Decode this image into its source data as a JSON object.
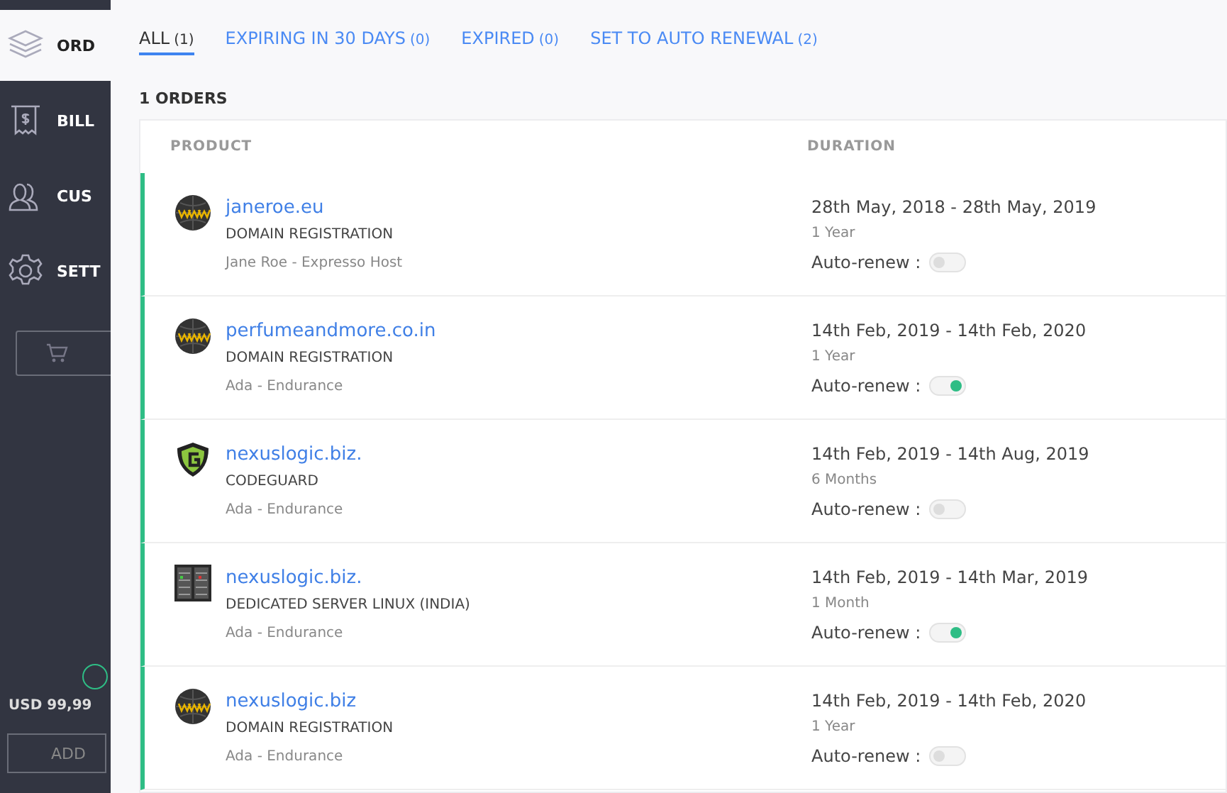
{
  "sidebar": {
    "items": [
      {
        "kind": "layers",
        "label": "ORD",
        "selected": true
      },
      {
        "kind": "receipt",
        "label": "BILL",
        "selected": false
      },
      {
        "kind": "users",
        "label": "CUS",
        "selected": false
      },
      {
        "kind": "gear",
        "label": "SETT",
        "selected": false
      }
    ],
    "cart_button": {
      "kind": "cart"
    },
    "balance": "USD 99,99",
    "add_button": "ADD"
  },
  "tabs": [
    {
      "label": "ALL",
      "count": "(1)",
      "selected": true
    },
    {
      "label": "EXPIRING IN 30 DAYS",
      "count": "(0)",
      "selected": false
    },
    {
      "label": "EXPIRED",
      "count": "(0)",
      "selected": false
    },
    {
      "label": "SET TO AUTO RENEWAL",
      "count": "(2)",
      "selected": false
    }
  ],
  "orders_count": "1 ORDERS",
  "table": {
    "columns": [
      "PRODUCT",
      "DURATION"
    ],
    "rows": [
      {
        "kind": "domain",
        "name": "janeroe.eu",
        "product": "DOMAIN REGISTRATION",
        "customer": "Jane Roe - Expresso Host",
        "dates": "28th May, 2018 - 28th May, 2019",
        "term": "1 Year",
        "renew_label": "Auto-renew :",
        "auto_renew": false
      },
      {
        "kind": "domain",
        "name": "perfumeandmore.co.in",
        "product": "DOMAIN REGISTRATION",
        "customer": "Ada - Endurance",
        "dates": "14th Feb, 2019 - 14th Feb, 2020",
        "term": "1 Year",
        "renew_label": "Auto-renew :",
        "auto_renew": true
      },
      {
        "kind": "shield",
        "name": "nexuslogic.biz.",
        "product": "CODEGUARD",
        "customer": "Ada - Endurance",
        "dates": "14th Feb, 2019 - 14th Aug, 2019",
        "term": "6 Months",
        "renew_label": "Auto-renew :",
        "auto_renew": false
      },
      {
        "kind": "server",
        "name": "nexuslogic.biz.",
        "product": "DEDICATED SERVER LINUX (INDIA)",
        "customer": "Ada - Endurance",
        "dates": "14th Feb, 2019 - 14th Mar, 2019",
        "term": "1 Month",
        "renew_label": "Auto-renew :",
        "auto_renew": true
      },
      {
        "kind": "domain",
        "name": "nexuslogic.biz",
        "product": "DOMAIN REGISTRATION",
        "customer": "Ada - Endurance",
        "dates": "14th Feb, 2019 - 14th Feb, 2020",
        "term": "1 Year",
        "renew_label": "Auto-renew :",
        "auto_renew": false
      }
    ]
  }
}
